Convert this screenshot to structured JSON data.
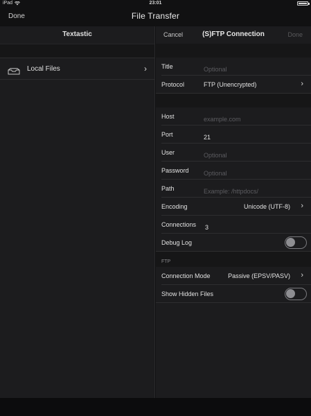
{
  "status_bar": {
    "device": "iPad",
    "time": "23:01"
  },
  "top_nav": {
    "done_label": "Done",
    "title": "File Transfer"
  },
  "left_pane": {
    "title": "Textastic",
    "items": [
      {
        "label": "Local Files",
        "icon": "tray-icon"
      }
    ]
  },
  "right_pane": {
    "cancel_label": "Cancel",
    "title": "(S)FTP Connection",
    "done_label": "Done",
    "group1": {
      "title": {
        "label": "Title",
        "placeholder": "Optional",
        "value": ""
      },
      "protocol": {
        "label": "Protocol",
        "value": "FTP (Unencrypted)"
      }
    },
    "group2": {
      "host": {
        "label": "Host",
        "placeholder": "example.com",
        "value": ""
      },
      "port": {
        "label": "Port",
        "value": "21"
      },
      "user": {
        "label": "User",
        "placeholder": "Optional",
        "value": ""
      },
      "password": {
        "label": "Password",
        "placeholder": "Optional",
        "value": ""
      },
      "path": {
        "label": "Path",
        "placeholder": "Example: /httpdocs/",
        "value": ""
      },
      "encoding": {
        "label": "Encoding",
        "value": "Unicode (UTF-8)"
      },
      "connections": {
        "label": "Connections",
        "value": "3"
      },
      "debug_log": {
        "label": "Debug Log",
        "on": false
      }
    },
    "ftp_section": {
      "header": "FTP",
      "connection_mode": {
        "label": "Connection Mode",
        "value": "Passive (EPSV/PASV)"
      },
      "show_hidden_files": {
        "label": "Show Hidden Files",
        "on": false
      }
    }
  },
  "colors": {
    "background": "#111112",
    "pane": "#1c1c1e",
    "separator": "#2e2e30",
    "placeholder": "#5c5c60",
    "text": "#e2e2e2",
    "disabled": "#5a5a5c"
  }
}
